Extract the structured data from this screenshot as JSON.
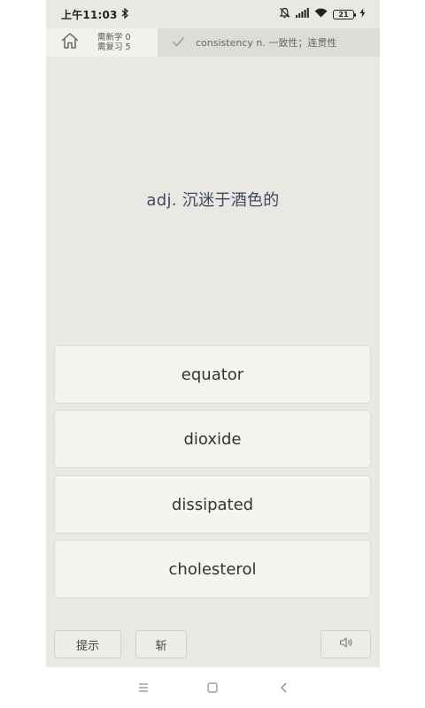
{
  "status_bar": {
    "time": "上午11:03",
    "battery": "21"
  },
  "tabs": {
    "new_count": "需新学 0",
    "review_count": "需复习 5",
    "previous_word": "consistency n. 一致性；连贯性"
  },
  "question": {
    "definition": "adj. 沉迷于酒色的"
  },
  "options": [
    {
      "label": "equator"
    },
    {
      "label": "dioxide"
    },
    {
      "label": "dissipated"
    },
    {
      "label": "cholesterol"
    }
  ],
  "toolbar": {
    "hint_label": "提示",
    "cut_label": "斩"
  },
  "colors": {
    "background": "#e9e8e3",
    "option_bg": "#f5f4f0",
    "definition_text": "#3c4a5c"
  }
}
